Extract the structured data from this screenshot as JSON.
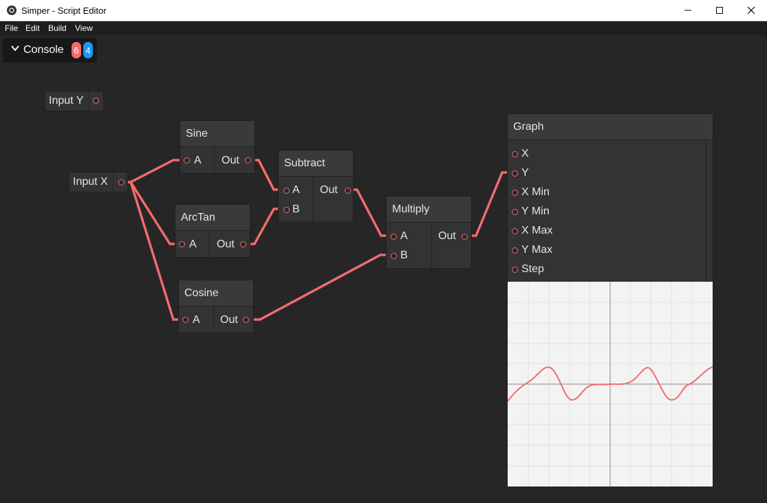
{
  "window": {
    "title": "Simper - Script Editor",
    "minimize": "—",
    "maximize": "☐",
    "close": "✕"
  },
  "menu": [
    "File",
    "Edit",
    "Build",
    "View"
  ],
  "console": {
    "label": "Console",
    "error_count": "6",
    "info_count": "4",
    "error_color": "#f26b6b",
    "info_color": "#2196f3"
  },
  "nodes": {
    "input_y": {
      "label": "Input Y"
    },
    "input_x": {
      "label": "Input X"
    },
    "sine": {
      "title": "Sine",
      "in_a": "A",
      "out": "Out"
    },
    "arctan": {
      "title": "ArcTan",
      "in_a": "A",
      "out": "Out"
    },
    "cosine": {
      "title": "Cosine",
      "in_a": "A",
      "out": "Out"
    },
    "subtract": {
      "title": "Subtract",
      "in_a": "A",
      "in_b": "B",
      "out": "Out"
    },
    "multiply": {
      "title": "Multiply",
      "in_a": "A",
      "in_b": "B",
      "out": "Out"
    },
    "graph": {
      "title": "Graph",
      "inputs": [
        "X",
        "Y",
        "X Min",
        "Y Min",
        "X Max",
        "Y Max",
        "Step"
      ]
    }
  },
  "wire_color": "#f26b6b"
}
